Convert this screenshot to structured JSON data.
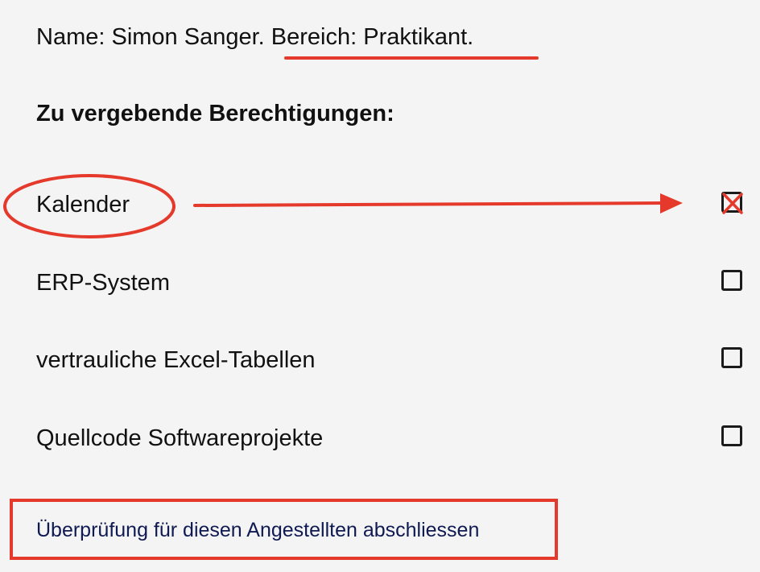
{
  "employee": {
    "name_label": "Name:",
    "name_value": "Simon Sanger.",
    "department_label": "Bereich:",
    "department_value": "Praktikant."
  },
  "permissions_heading": "Zu vergebende Berechtigungen:",
  "permissions": [
    {
      "label": "Kalender",
      "checked": true
    },
    {
      "label": "ERP-System",
      "checked": false
    },
    {
      "label": "vertrauliche Excel-Tabellen",
      "checked": false
    },
    {
      "label": "Quellcode Softwareprojekte",
      "checked": false
    }
  ],
  "finish_link": "Überprüfung für diesen Angestellten abschliessen",
  "colors": {
    "background": "#f4f4f4",
    "text": "#111111",
    "link": "#101a52",
    "annotation_red": "#e53a2b",
    "checkbox_border": "#1b1b1b"
  }
}
